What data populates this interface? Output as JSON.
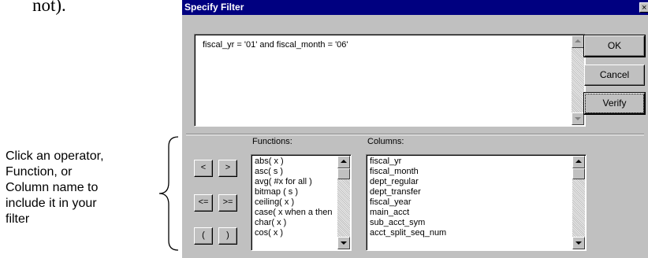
{
  "page": {
    "top_text": "not)."
  },
  "annotation": {
    "lines": [
      "Click an operator,",
      "Function, or",
      "Column name to",
      "include it in your",
      "filter"
    ]
  },
  "dialog": {
    "title": "Specify Filter",
    "close_glyph": "×",
    "filter_expression": "fiscal_yr = '01' and  fiscal_month = '06'",
    "buttons": {
      "ok": "OK",
      "cancel": "Cancel",
      "verify": "Verify"
    },
    "functions_label": "Functions:",
    "columns_label": "Columns:",
    "operators": [
      "<",
      ">",
      "<=",
      ">=",
      "(",
      ")"
    ],
    "functions": [
      "abs( x )",
      "asc( s )",
      "avg( #x for all )",
      "bitmap ( s )",
      "ceiling( x )",
      "case( x when a then",
      "char( x )",
      "cos( x )"
    ],
    "columns": [
      "fiscal_yr",
      "fiscal_month",
      "dept_regular",
      "dept_transfer",
      "fiscal_year",
      "main_acct",
      "sub_acct_sym",
      "acct_split_seq_num"
    ]
  }
}
